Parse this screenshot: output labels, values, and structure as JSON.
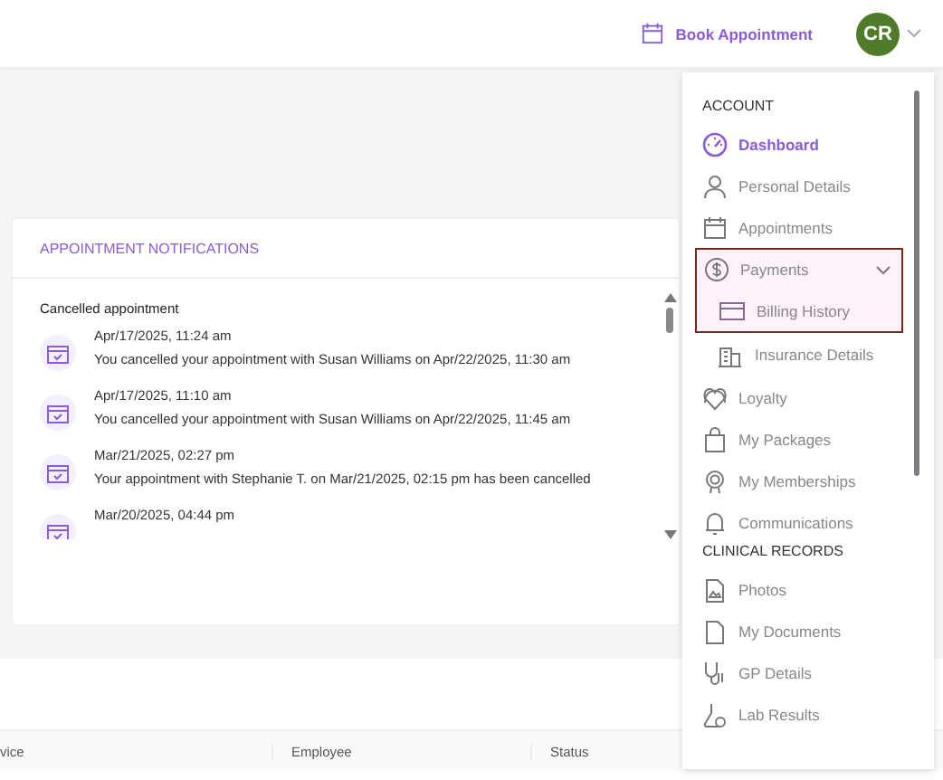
{
  "header": {
    "book_button": "Book Appointment",
    "avatar": "CR"
  },
  "notifications": {
    "title": "APPOINTMENT NOTIFICATIONS",
    "group": "Cancelled appointment",
    "items": [
      {
        "time": "Apr/17/2025, 11:24 am",
        "text": "You cancelled your appointment with Susan Williams on Apr/22/2025, 11:30 am"
      },
      {
        "time": "Apr/17/2025, 11:10 am",
        "text": "You cancelled your appointment with Susan Williams on Apr/22/2025, 11:45 am"
      },
      {
        "time": "Mar/21/2025, 02:27 pm",
        "text": "Your appointment with Stephanie T. on Mar/21/2025, 02:15 pm has been cancelled"
      },
      {
        "time": "Mar/20/2025, 04:44 pm"
      }
    ]
  },
  "table": {
    "columns": [
      "vice",
      "Employee",
      "Status"
    ]
  },
  "menu": [
    {
      "kind": "section",
      "label": "ACCOUNT"
    },
    {
      "kind": "item",
      "label": "Dashboard",
      "selected": true
    },
    {
      "kind": "item",
      "label": "Personal Details",
      "selected": false
    },
    {
      "kind": "item",
      "label": "Appointments",
      "selected": false
    },
    {
      "kind": "item",
      "label": "Payments",
      "selected": false,
      "expanded": true,
      "highlighted": true,
      "children": [
        {
          "label": "Billing History",
          "selected": false,
          "highlighted": true
        },
        {
          "label": "Insurance Details",
          "selected": false,
          "highlighted": false
        }
      ]
    },
    {
      "kind": "item",
      "label": "Loyalty",
      "selected": false
    },
    {
      "kind": "item",
      "label": "My Packages",
      "selected": false
    },
    {
      "kind": "item",
      "label": "My Memberships",
      "selected": false
    },
    {
      "kind": "item",
      "label": "Communications",
      "selected": false
    },
    {
      "kind": "section",
      "label": "CLINICAL RECORDS"
    },
    {
      "kind": "item",
      "label": "Photos",
      "selected": false
    },
    {
      "kind": "item",
      "label": "My Documents",
      "selected": false
    },
    {
      "kind": "item",
      "label": "GP Details",
      "selected": false
    },
    {
      "kind": "item",
      "label": "Lab Results",
      "selected": false
    }
  ]
}
